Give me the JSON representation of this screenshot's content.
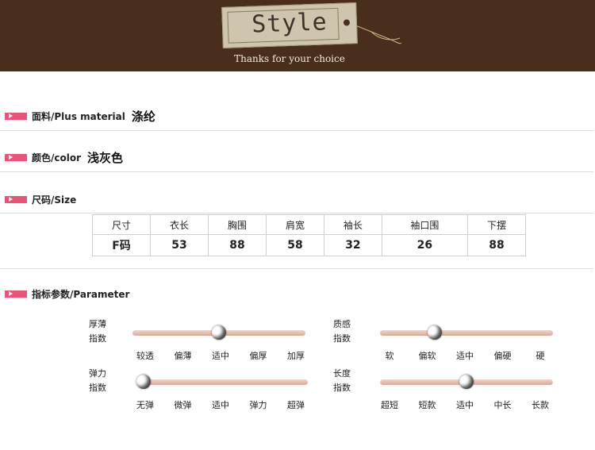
{
  "banner": {
    "tag_word": "Style",
    "subtitle": "Thanks for your choice"
  },
  "sections": {
    "material": {
      "label": "面料/Plus material",
      "value": "涤纶"
    },
    "color": {
      "label": "颜色/color",
      "value": "浅灰色"
    },
    "size": {
      "label": "尺码/Size"
    },
    "parameter": {
      "label": "指标参数/Parameter"
    }
  },
  "size_table": {
    "headers": [
      "尺寸",
      "衣长",
      "胸围",
      "肩宽",
      "袖长",
      "袖口围",
      "下摆"
    ],
    "row": [
      "F码",
      "53",
      "88",
      "58",
      "32",
      "26",
      "88"
    ]
  },
  "parameters": {
    "thickness": {
      "label_1": "厚薄",
      "label_2": "指数",
      "ticks": [
        "较透",
        "偏薄",
        "适中",
        "偏厚",
        "加厚"
      ],
      "level": 0.5
    },
    "stretch": {
      "label_1": "弹力",
      "label_2": "指数",
      "ticks": [
        "无弹",
        "微弹",
        "适中",
        "弹力",
        "超弹"
      ],
      "level": 0.0
    },
    "texture": {
      "label_1": "质感",
      "label_2": "指数",
      "ticks": [
        "软",
        "偏软",
        "适中",
        "偏硬",
        "硬"
      ],
      "level": 0.3
    },
    "length": {
      "label_1": "长度",
      "label_2": "指数",
      "ticks": [
        "超短",
        "短款",
        "适中",
        "中长",
        "长款"
      ],
      "level": 0.5
    }
  }
}
